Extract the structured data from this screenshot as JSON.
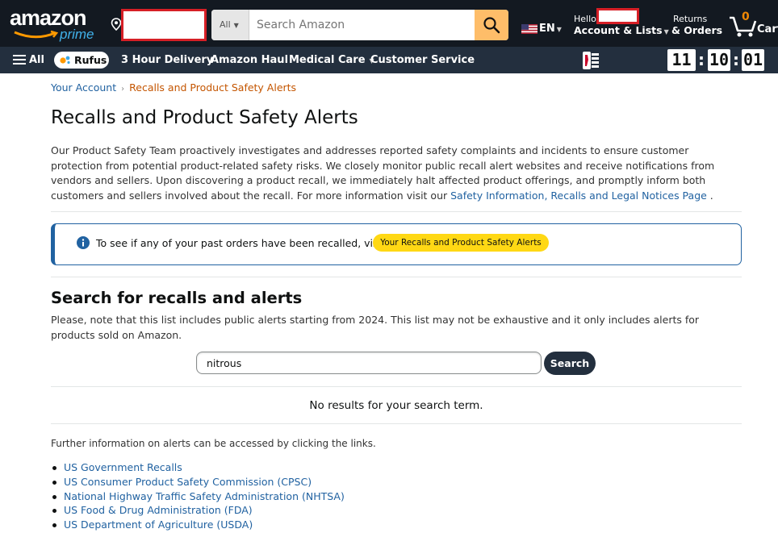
{
  "header": {
    "logo_text": "amazon",
    "logo_sub": "prime",
    "search": {
      "category": "All",
      "placeholder": "Search Amazon"
    },
    "language": "EN",
    "account_greeting": "Hello",
    "account_label": "Account & Lists",
    "returns_line1": "Returns",
    "returns_line2": "& Orders",
    "cart_count": "0",
    "cart_label": "Cart"
  },
  "subnav": {
    "all_label": "All",
    "rufus_label": "Rufus",
    "items": [
      "3 Hour Delivery",
      "Amazon Haul",
      "Medical Care",
      "Customer Service"
    ],
    "clock": [
      "11",
      "10",
      "01"
    ]
  },
  "breadcrumb": {
    "parent": "Your Account",
    "current": "Recalls and Product Safety Alerts"
  },
  "page_title": "Recalls and Product Safety Alerts",
  "intro": {
    "text": "Our Product Safety Team proactively investigates and addresses reported safety complaints and incidents to ensure customer protection from potential product-related safety risks. We closely monitor public recall alert websites and receive notifications from vendors and sellers. Upon discovering a product recall, we immediately halt affected product offerings, and promptly inform both customers and sellers involved about the recall. For more information visit our",
    "link": "Safety Information, Recalls and Legal Notices Page",
    "end": " ."
  },
  "alert": {
    "text": "To see if any of your past orders have been recalled, visit",
    "button": "Your Recalls and Product Safety Alerts"
  },
  "search_section": {
    "heading": "Search for recalls and alerts",
    "note": "Please, note that this list includes public alerts starting from 2024. This list may not be exhaustive and it only includes alerts for products sold on Amazon.",
    "query": "nitrous",
    "button": "Search",
    "no_results": "No results for your search term."
  },
  "further_info": "Further information on alerts can be accessed by clicking the links.",
  "links": [
    "US Government Recalls",
    "US Consumer Product Safety Commission (CPSC)",
    "National Highway Traffic Safety Administration (NHTSA)",
    "US Food & Drug Administration (FDA)",
    "US Department of Agriculture (USDA)"
  ],
  "colors": {
    "nav_dark": "#131921",
    "nav_secondary": "#232f3e",
    "search_button": "#febd69",
    "link": "#2162a1",
    "breadcrumb_current": "#c45500",
    "alert_button": "#ffd814",
    "redaction_border": "#d61f26"
  },
  "icons": [
    "location-icon",
    "search-icon",
    "us-flag-icon",
    "cart-icon",
    "menu-icon",
    "rufus-icon",
    "nba-logo-icon",
    "info-icon"
  ]
}
